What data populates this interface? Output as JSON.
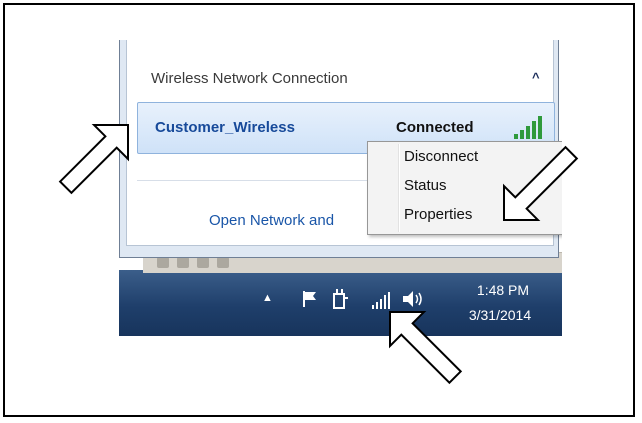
{
  "network_panel": {
    "section_title": "Wireless Network Connection",
    "collapse_glyph": "^",
    "network": {
      "name": "Customer_Wireless",
      "status": "Connected"
    },
    "open_link": "Open Network and"
  },
  "context_menu": {
    "items": [
      {
        "label": "Disconnect"
      },
      {
        "label": "Status"
      },
      {
        "label": "Properties"
      }
    ]
  },
  "taskbar": {
    "show_hidden_glyph": "▲",
    "icons": [
      "action-center-flag-icon",
      "power-plug-icon",
      "wireless-signal-icon",
      "speaker-volume-icon"
    ],
    "clock": {
      "time": "1:48 PM",
      "date": "3/31/2014"
    }
  },
  "callouts": {
    "arrow_count": 3,
    "targets": [
      "network-entry",
      "properties-menu-item",
      "tray-wireless-icon"
    ]
  },
  "colors": {
    "taskbar": "#1f3f6b",
    "link": "#1a56a8",
    "network_name": "#174a9a",
    "signal": "#2f9a3c"
  }
}
